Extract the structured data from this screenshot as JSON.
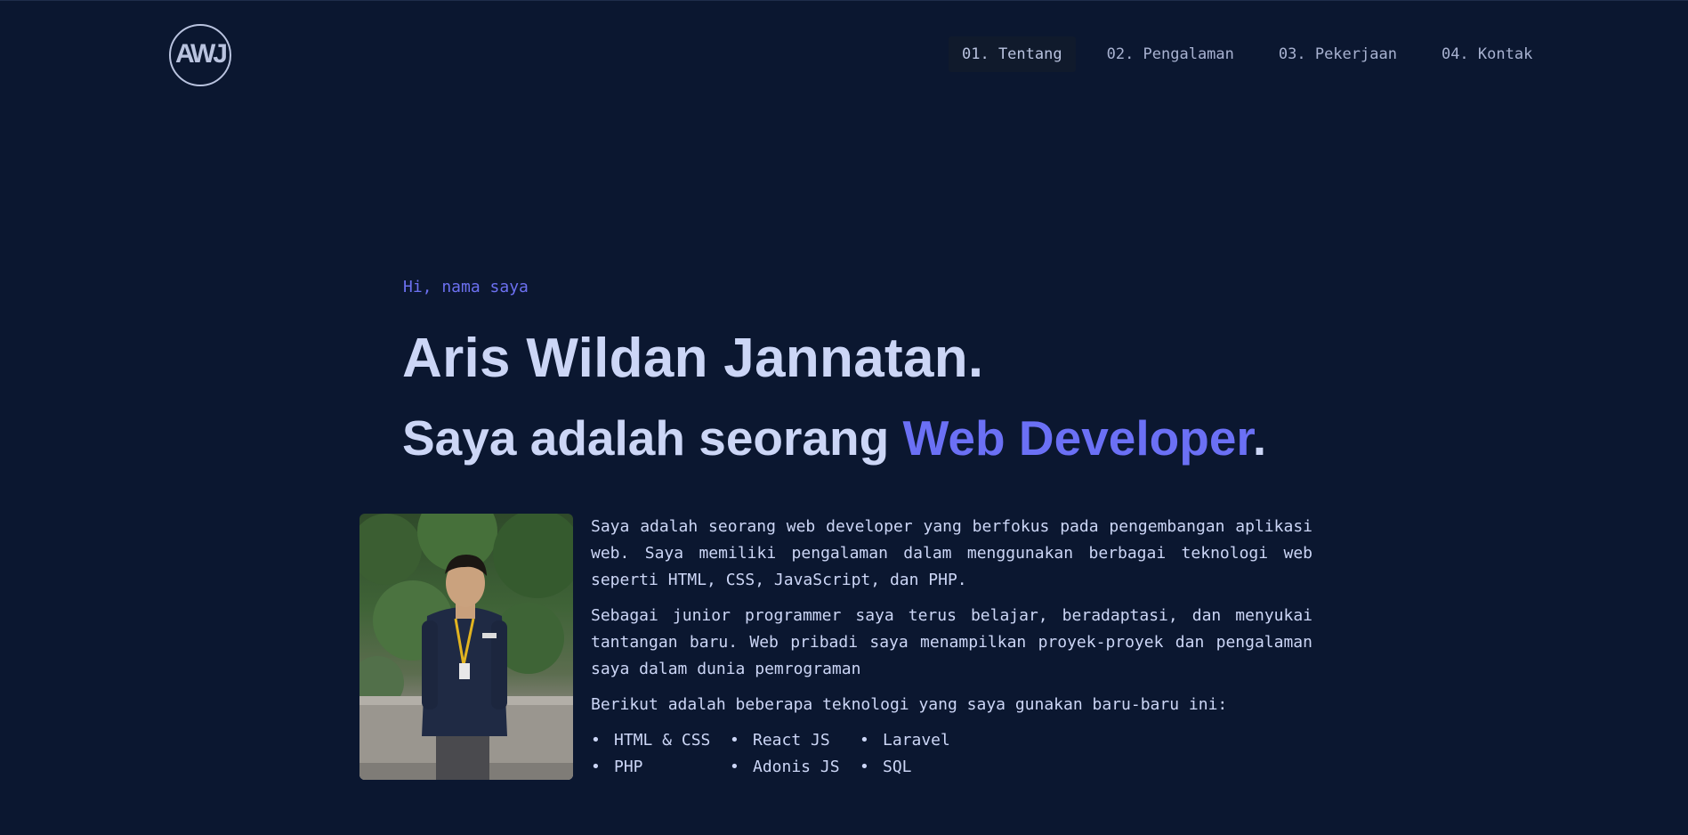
{
  "header": {
    "logo_text": "AWJ",
    "nav": [
      {
        "label": "01. Tentang",
        "active": true
      },
      {
        "label": "02. Pengalaman",
        "active": false
      },
      {
        "label": "03. Pekerjaan",
        "active": false
      },
      {
        "label": "04. Kontak",
        "active": false
      }
    ]
  },
  "hero": {
    "greeting": "Hi, nama saya",
    "name": "Aris Wildan Jannatan.",
    "tagline_prefix": "Saya adalah seorang ",
    "tagline_accent": "Web Developer",
    "tagline_suffix": "."
  },
  "about": {
    "paragraphs": [
      "Saya adalah seorang web developer yang berfokus pada pengembangan aplikasi web. Saya memiliki pengalaman dalam menggunakan berbagai teknologi web seperti HTML, CSS, JavaScript, dan PHP.",
      "Sebagai junior programmer saya terus belajar, beradaptasi, dan menyukai tantangan baru. Web pribadi saya menampilkan proyek-proyek dan pengalaman saya dalam dunia pemrograman",
      "Berikut adalah beberapa teknologi yang saya gunakan baru-baru ini:"
    ],
    "technologies": [
      "HTML & CSS",
      "React JS",
      "Laravel",
      "PHP",
      "Adonis JS",
      "SQL"
    ]
  },
  "colors": {
    "background": "#0b1730",
    "text": "#ccd6f6",
    "accent": "#6b70f5",
    "nav_text": "#a8b2d1"
  }
}
